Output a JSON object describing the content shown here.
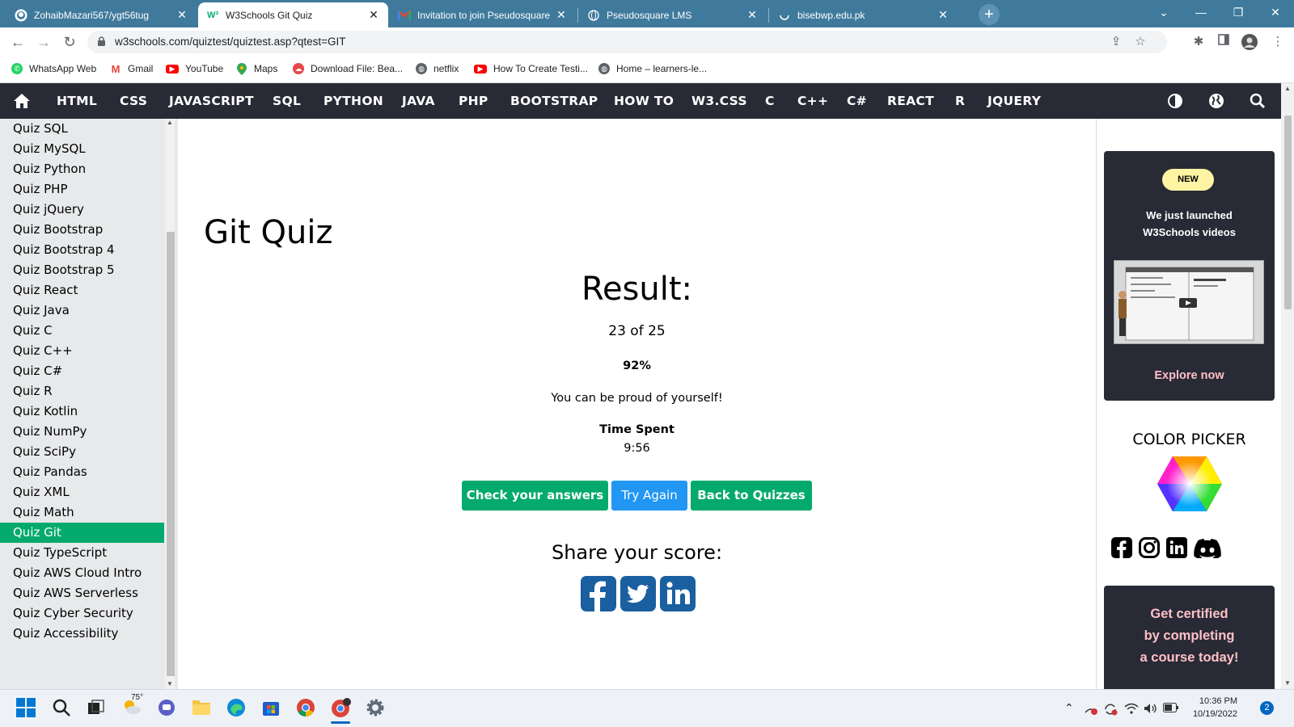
{
  "browser": {
    "tabs": [
      {
        "title": "ZohaibMazari567/ygt56tug",
        "icon": "github-icon"
      },
      {
        "title": "W3Schools Git Quiz",
        "icon": "w3schools-icon",
        "active": true
      },
      {
        "title": "Invitation to join Pseudosquare",
        "icon": "gmail-icon"
      },
      {
        "title": "Pseudosquare LMS",
        "icon": "globe-icon"
      },
      {
        "title": "bisebwp.edu.pk",
        "icon": "loading-icon"
      }
    ],
    "url": "w3schools.com/quiztest/quiztest.asp?qtest=GIT",
    "bookmarks": [
      {
        "label": "WhatsApp Web",
        "icon": "whatsapp-icon",
        "color": "#25d366"
      },
      {
        "label": "Gmail",
        "icon": "gmail-icon",
        "color": "#ea4335"
      },
      {
        "label": "YouTube",
        "icon": "youtube-icon",
        "color": "#ff0000"
      },
      {
        "label": "Maps",
        "icon": "maps-icon",
        "color": "#34a853"
      },
      {
        "label": "Download File: Bea...",
        "icon": "download-icon",
        "color": "#e5484d"
      },
      {
        "label": "netflix",
        "icon": "globe-icon",
        "color": "#5f6368"
      },
      {
        "label": "How To Create Testi...",
        "icon": "youtube-icon",
        "color": "#ff0000"
      },
      {
        "label": "Home – learners-le...",
        "icon": "globe-icon",
        "color": "#5f6368"
      }
    ]
  },
  "topnav": {
    "links": [
      "HTML",
      "CSS",
      "JAVASCRIPT",
      "SQL",
      "PYTHON",
      "JAVA",
      "PHP",
      "BOOTSTRAP",
      "HOW TO",
      "W3.CSS",
      "C",
      "C++",
      "C#",
      "REACT",
      "R",
      "JQUERY"
    ],
    "bg_color": "#282a35"
  },
  "sidebar": {
    "items": [
      "Quiz SQL",
      "Quiz MySQL",
      "Quiz Python",
      "Quiz PHP",
      "Quiz jQuery",
      "Quiz Bootstrap",
      "Quiz Bootstrap 4",
      "Quiz Bootstrap 5",
      "Quiz React",
      "Quiz Java",
      "Quiz C",
      "Quiz C++",
      "Quiz C#",
      "Quiz R",
      "Quiz Kotlin",
      "Quiz NumPy",
      "Quiz SciPy",
      "Quiz Pandas",
      "Quiz XML",
      "Quiz Math",
      "Quiz Git",
      "Quiz TypeScript",
      "Quiz AWS Cloud Intro",
      "Quiz AWS Serverless",
      "Quiz Cyber Security",
      "Quiz Accessibility"
    ],
    "active_item": "Quiz Git",
    "active_color": "#04aa6d"
  },
  "main": {
    "title": "Git Quiz",
    "result_heading": "Result:",
    "score_text": "23 of 25",
    "percent": "92%",
    "message": "You can be proud of yourself!",
    "time_label": "Time Spent",
    "time_value": "9:56",
    "buttons": {
      "check": "Check your answers",
      "try_again": "Try Again",
      "back": "Back to Quizzes"
    },
    "share_heading": "Share your score:",
    "share_icons": [
      "facebook-icon",
      "twitter-icon",
      "linkedin-icon"
    ],
    "green": "#04aa6d",
    "blue": "#2196f3"
  },
  "rightcol": {
    "badge": "NEW",
    "promo_line1": "We just launched",
    "promo_line2": "W3Schools videos",
    "promo_cta": "Explore now",
    "color_picker_title": "COLOR PICKER",
    "social_icons": [
      "facebook-icon",
      "instagram-icon",
      "linkedin-icon",
      "discord-icon"
    ],
    "cert_line1": "Get certified",
    "cert_line2": "by completing",
    "cert_line3": "a course today!",
    "pink": "#ffc0c7",
    "yellow": "#fff4a3"
  },
  "taskbar": {
    "weather_temp": "75°",
    "time": "10:36 PM",
    "date": "10/19/2022",
    "notification_count": "2"
  }
}
